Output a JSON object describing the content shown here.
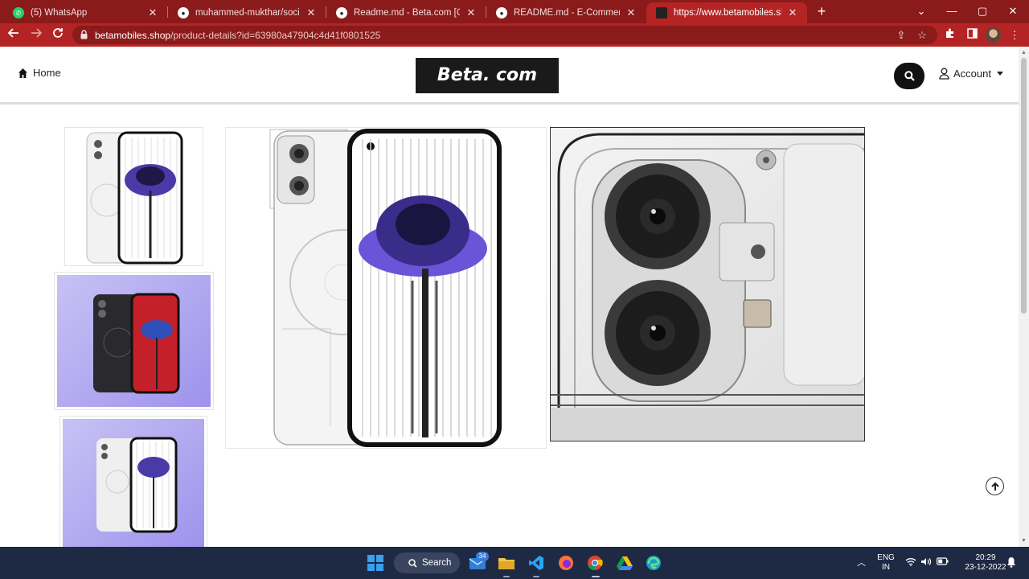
{
  "browser": {
    "tabs": [
      {
        "label": "(5) WhatsApp",
        "favicon_color": "#25d366"
      },
      {
        "label": "muhammed-mukthar/socio-fron",
        "favicon_color": "#ffffff"
      },
      {
        "label": "Readme.md - Beta.com [GitHub]",
        "favicon_color": "#ffffff"
      },
      {
        "label": "README.md - E-Commerce-app",
        "favicon_color": "#ffffff"
      },
      {
        "label": "https://www.betamobiles.shop/p",
        "favicon_color": "#222222"
      }
    ],
    "url_domain": "betamobiles.shop",
    "url_path": "/product-details?id=63980a47904c4d41f0801525"
  },
  "navbar": {
    "home_label": "Home",
    "logo_text": "Beta. com",
    "account_label": "Account"
  },
  "product": {
    "thumbnails": [
      "thumb-white-phone",
      "thumb-black-red-phone",
      "thumb-white-phone-purple"
    ],
    "main_image": "white-phone-front-back",
    "zoom_image": "camera-closeup"
  },
  "taskbar": {
    "search_label": "Search",
    "mail_badge": "34",
    "lang_line1": "ENG",
    "lang_line2": "IN",
    "time": "20:29",
    "date": "23-12-2022"
  },
  "colors": {
    "chrome_dark": "#8b1a1a",
    "chrome_accent": "#b52424",
    "taskbar": "#1e2a44"
  }
}
